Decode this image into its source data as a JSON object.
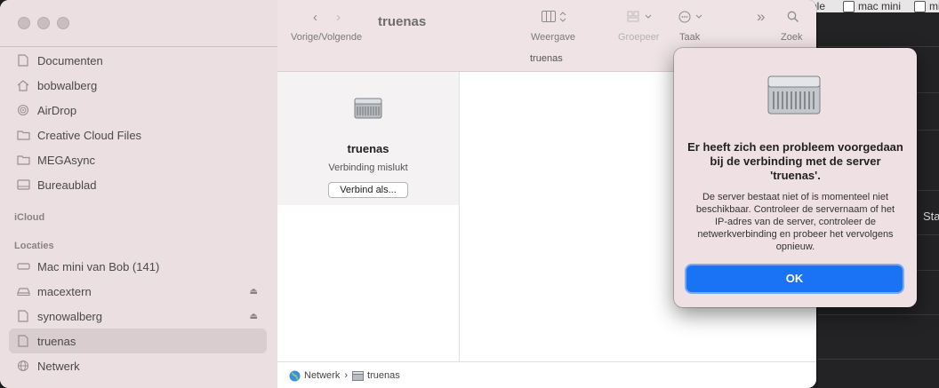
{
  "desktop": {
    "items": [
      {
        "label": "ple"
      },
      {
        "label": "mac mini"
      },
      {
        "label": "mi"
      }
    ],
    "side_text": "Sta"
  },
  "sidebar": {
    "items": [
      {
        "label": "Documenten",
        "icon": "document-icon"
      },
      {
        "label": "bobwalberg",
        "icon": "home-icon"
      },
      {
        "label": "AirDrop",
        "icon": "airdrop-icon"
      },
      {
        "label": "Creative Cloud Files",
        "icon": "folder-icon"
      },
      {
        "label": "MEGAsync",
        "icon": "folder-icon"
      },
      {
        "label": "Bureaublad",
        "icon": "desktop-icon"
      }
    ],
    "icloud_header": "iCloud",
    "locations_header": "Locaties",
    "locations": [
      {
        "label": "Mac mini van Bob (141)",
        "icon": "computer-icon"
      },
      {
        "label": "macextern",
        "icon": "drive-icon"
      },
      {
        "label": "synowalberg",
        "icon": "document-icon"
      },
      {
        "label": "truenas",
        "icon": "document-icon"
      },
      {
        "label": "Netwerk",
        "icon": "network-icon"
      }
    ]
  },
  "toolbar": {
    "title": "truenas",
    "back_forward_label": "Vorige/Volgende",
    "view_label": "Weergave",
    "group_label": "Groepeer",
    "action_label": "Taak",
    "search_label": "Zoek",
    "path_title": "truenas"
  },
  "content": {
    "server_name": "truenas",
    "status": "Verbinding mislukt",
    "connect_button": "Verbind als..."
  },
  "pathbar": {
    "network": "Netwerk",
    "separator": "›",
    "server": "truenas"
  },
  "dialog": {
    "title": "Er heeft zich een probleem voorgedaan bij de verbinding met de server 'truenas'.",
    "message": "De server bestaat niet of is momenteel niet beschikbaar. Controleer de servernaam of het IP-adres van de server, controleer de netwerkverbinding en probeer het vervolgens opnieuw.",
    "ok_label": "OK"
  },
  "colors": {
    "accent": "#1a73f5",
    "sidebar_bg": "#ecdfe1",
    "dialog_bg": "#efe0e3"
  }
}
